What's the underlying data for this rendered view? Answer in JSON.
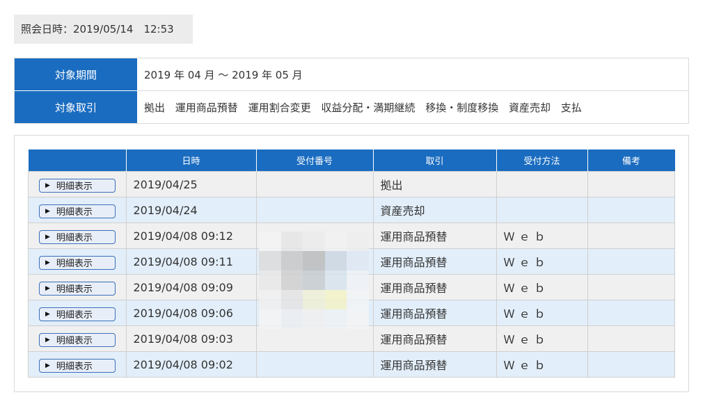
{
  "inquiry": {
    "label": "照会日時：2019/05/14　12:53"
  },
  "conditions": {
    "period_label": "対象期間",
    "period_value": "2019 年 04 月 ～ 2019 年 05 月",
    "trades_label": "対象取引",
    "trades": [
      "拠出",
      "運用商品預替",
      "運用割合変更",
      "収益分配・満期継続",
      "移換・制度移換",
      "資産売却",
      "支払"
    ]
  },
  "table": {
    "headers": [
      "",
      "日時",
      "受付番号",
      "取引",
      "受付方法",
      "備考"
    ],
    "detail_button_label": "明細表示",
    "rows": [
      {
        "date": "2019/04/25",
        "receipt": "",
        "trade": "拠出",
        "method": "",
        "note": ""
      },
      {
        "date": "2019/04/24",
        "receipt": "",
        "trade": "資産売却",
        "method": "",
        "note": ""
      },
      {
        "date": "2019/04/08 09:12",
        "receipt": "",
        "trade": "運用商品預替",
        "method": "Ｗｅｂ",
        "note": ""
      },
      {
        "date": "2019/04/08 09:11",
        "receipt": "",
        "trade": "運用商品預替",
        "method": "Ｗｅｂ",
        "note": ""
      },
      {
        "date": "2019/04/08 09:09",
        "receipt": "",
        "trade": "運用商品預替",
        "method": "Ｗｅｂ",
        "note": ""
      },
      {
        "date": "2019/04/08 09:06",
        "receipt": "",
        "trade": "運用商品預替",
        "method": "Ｗｅｂ",
        "note": ""
      },
      {
        "date": "2019/04/08 09:03",
        "receipt": "",
        "trade": "運用商品預替",
        "method": "Ｗｅｂ",
        "note": ""
      },
      {
        "date": "2019/04/08 09:02",
        "receipt": "",
        "trade": "運用商品預替",
        "method": "Ｗｅｂ",
        "note": ""
      }
    ]
  },
  "colors": {
    "header_blue": "#1a6cc0",
    "row_gray": "#f0f0f0",
    "row_blue": "#e2eef9"
  }
}
